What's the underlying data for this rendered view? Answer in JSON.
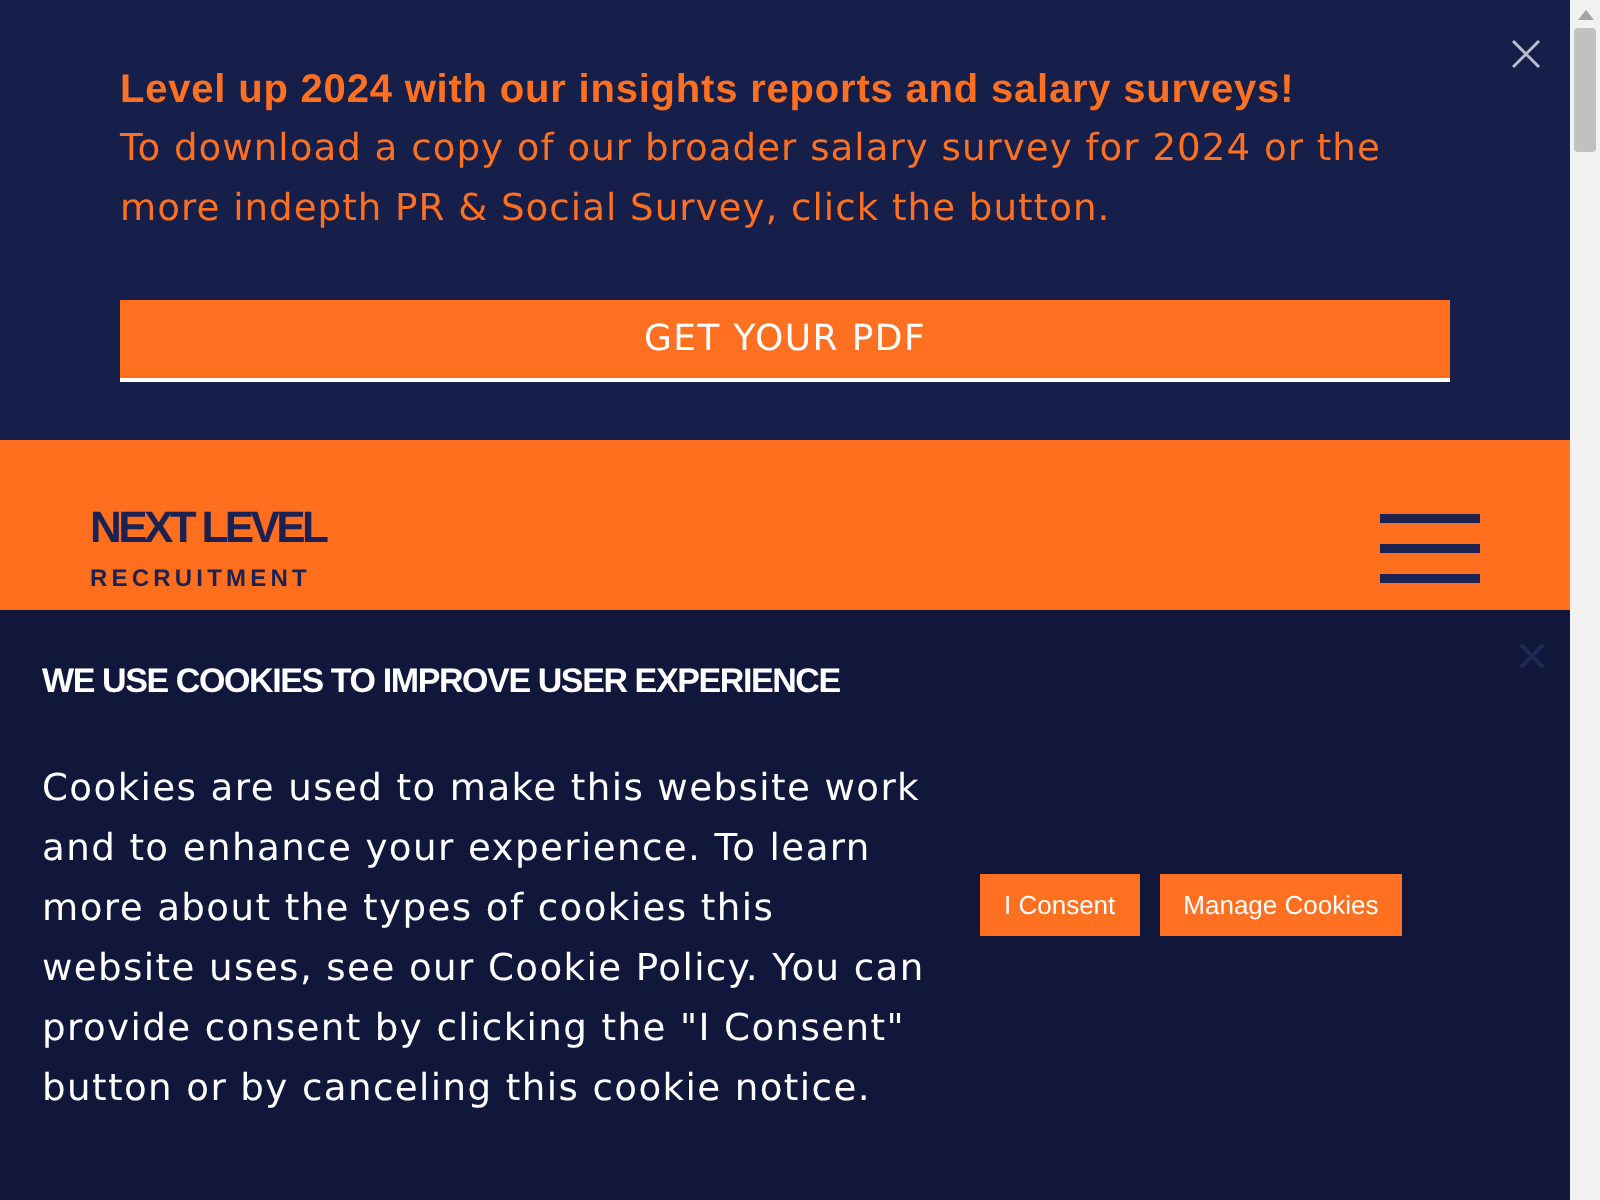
{
  "promo_banner": {
    "heading": "Level up 2024 with our insights reports and salary surveys!",
    "text": "To download a copy of our broader salary survey for 2024 or the more indepth PR & Social Survey, click the button.",
    "button": "GET YOUR PDF"
  },
  "header": {
    "logo": {
      "name": "NEXT LEVEL",
      "tagline": "RECRUITMENT"
    }
  },
  "cookie_banner": {
    "title": "WE USE COOKIES TO IMPROVE USER EXPERIENCE",
    "text": "Cookies are used to make this website work and to enhance your experience. To learn more about the types of cookies this website uses, see our Cookie Policy. You can provide consent by clicking the \"I Consent\" button or by canceling this cookie notice.",
    "buttons": [
      "I Consent",
      "Manage Cookies"
    ]
  }
}
